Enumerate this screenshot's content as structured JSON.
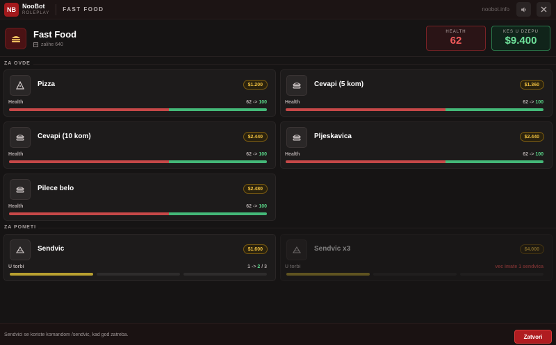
{
  "app": {
    "logo": "NB",
    "name": "NooBot",
    "tagline": "ROLEPLAY",
    "section": "FAST FOOD",
    "site": "noobot.info"
  },
  "header": {
    "title": "Fast Food",
    "subtitle": "zalihe 640",
    "icon": "burger-icon"
  },
  "stats": {
    "health": {
      "label": "HEALTH",
      "value": "62"
    },
    "cash": {
      "label": "KES U DZEPU",
      "value": "$9.400"
    }
  },
  "sections": {
    "eat_here": "ZA OVDE",
    "take_away": "ZA PONETI"
  },
  "eat_here": [
    {
      "name": "Pizza",
      "price": "$1.200",
      "health_label": "Health",
      "from": "62 -> ",
      "to": "100",
      "icon": "pizza-icon",
      "health_fraction": 0.62
    },
    {
      "name": "Cevapi (5 kom)",
      "price": "$1.360",
      "health_label": "Health",
      "from": "62 -> ",
      "to": "100",
      "icon": "burger-icon",
      "health_fraction": 0.62
    },
    {
      "name": "Cevapi (10 kom)",
      "price": "$2.440",
      "health_label": "Health",
      "from": "62 -> ",
      "to": "100",
      "icon": "burger-icon",
      "health_fraction": 0.62
    },
    {
      "name": "Pljeskavica",
      "price": "$2.440",
      "health_label": "Health",
      "from": "62 -> ",
      "to": "100",
      "icon": "burger-icon",
      "health_fraction": 0.62
    },
    {
      "name": "Pilece belo",
      "price": "$2.480",
      "health_label": "Health",
      "from": "62 -> ",
      "to": "100",
      "icon": "burger-icon",
      "health_fraction": 0.62
    }
  ],
  "take_away": [
    {
      "name": "Sendvic",
      "price": "$1.600",
      "bag_label": "U torbi",
      "bag_from": "1 -> ",
      "bag_to": "2",
      "bag_max": " / 3",
      "icon": "sandwich-icon",
      "filled": 1
    },
    {
      "name": "Sendvic x3",
      "price": "$4.000",
      "bag_label": "U torbi",
      "warning": "vec imate 1 sendvica",
      "icon": "sandwich-icon",
      "filled": 1
    }
  ],
  "footer": {
    "hint": "Sendvici se koriste komandom /sendvic, kad god zatreba.",
    "close_label": "Zatvori"
  },
  "colors": {
    "accent": "#b01c20",
    "health": "#f05a5a",
    "cash": "#6ee09a",
    "price": "#f0c040"
  }
}
